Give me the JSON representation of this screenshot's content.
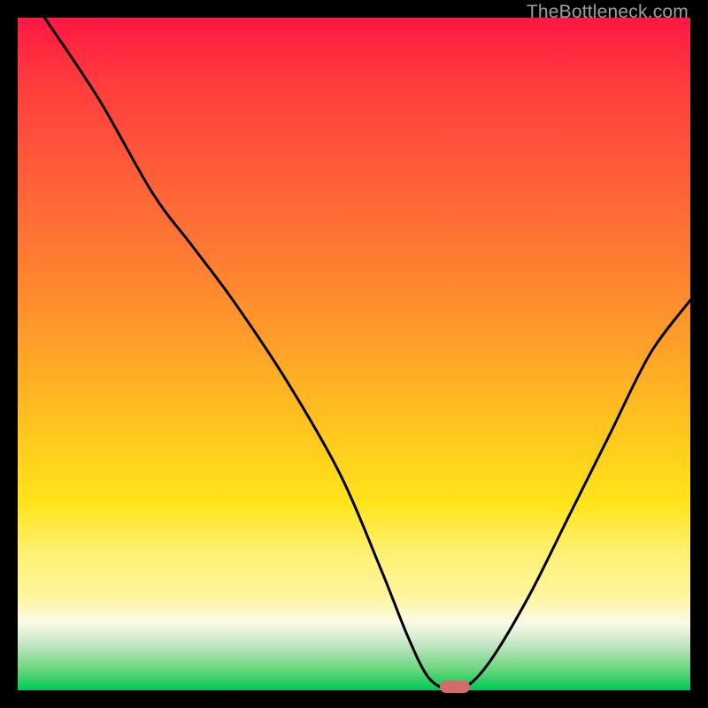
{
  "watermark": {
    "text": "TheBottleneck.com"
  },
  "chart_data": {
    "type": "line",
    "title": "",
    "xlabel": "",
    "ylabel": "",
    "xlim": [
      0,
      100
    ],
    "ylim": [
      0,
      100
    ],
    "grid": false,
    "gradient_stops": [
      {
        "pos": 0,
        "color": "#ff1744"
      },
      {
        "pos": 10,
        "color": "#ff3d3d"
      },
      {
        "pos": 22,
        "color": "#ff5a3a"
      },
      {
        "pos": 35,
        "color": "#ff7a33"
      },
      {
        "pos": 50,
        "color": "#ffa428"
      },
      {
        "pos": 62,
        "color": "#ffc81e"
      },
      {
        "pos": 72,
        "color": "#ffe41a"
      },
      {
        "pos": 80,
        "color": "#fff176"
      },
      {
        "pos": 86,
        "color": "#fff59d"
      },
      {
        "pos": 90,
        "color": "#f9fbe7"
      },
      {
        "pos": 93,
        "color": "#c8e6c9"
      },
      {
        "pos": 97,
        "color": "#66d67a"
      },
      {
        "pos": 100,
        "color": "#00c853"
      }
    ],
    "series": [
      {
        "name": "bottleneck-curve",
        "x": [
          4,
          12,
          20,
          26,
          32,
          40,
          48,
          54,
          58,
          61,
          64,
          66,
          70,
          76,
          82,
          88,
          94,
          100
        ],
        "values": [
          100,
          88,
          74,
          66,
          58,
          46,
          32,
          18,
          8,
          2,
          0,
          0,
          4,
          14,
          26,
          38,
          50,
          58
        ]
      }
    ],
    "marker": {
      "x": 65,
      "y": 0,
      "color": "#d46a6a",
      "shape": "pill"
    }
  }
}
